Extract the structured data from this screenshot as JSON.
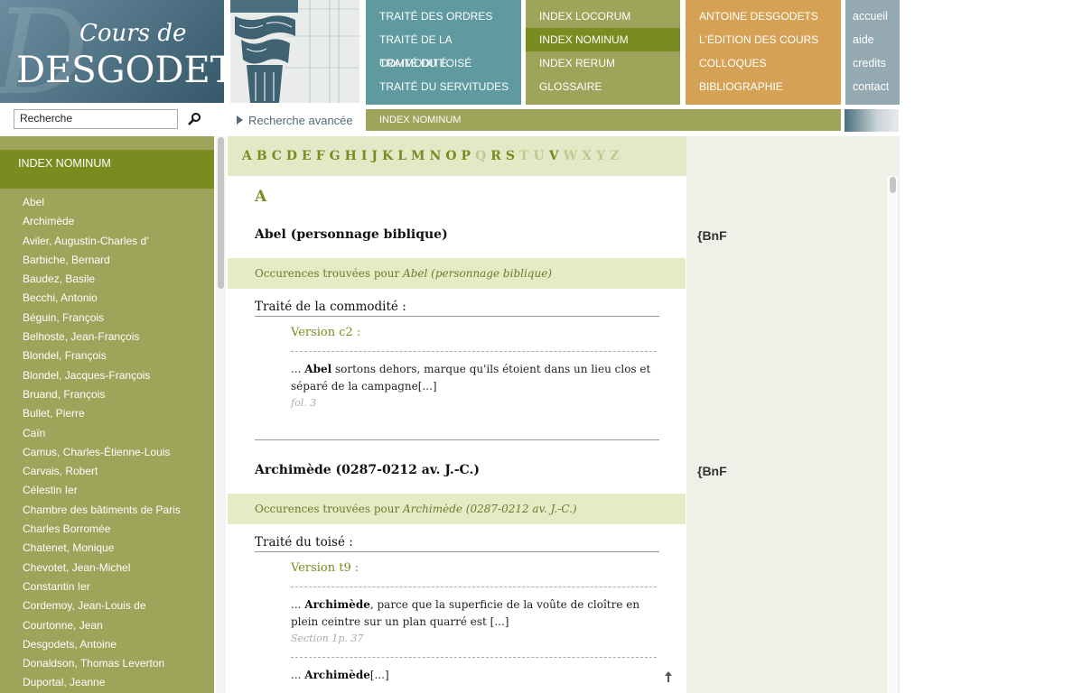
{
  "logo": {
    "line1": "Cours de",
    "line2": "DESGODETS",
    "watermark": "D"
  },
  "nav": {
    "col1": [
      "TRAITÉ DES ORDRES",
      "TRAITÉ DE LA COMMODITÉ",
      "TRAITÉ DU TOISÉ",
      "TRAITÉ DU SERVITUDES"
    ],
    "col2": [
      "INDEX LOCORUM",
      "INDEX NOMINUM",
      "INDEX RERUM",
      "GLOSSAIRE"
    ],
    "col3": [
      "ANTOINE DESGODETS",
      "L'ÉDITION DES COURS",
      "COLLOQUES",
      "BIBLIOGRAPHIE"
    ],
    "col4": [
      "accueil",
      "aide",
      "credits",
      "contact"
    ],
    "active": "INDEX NOMINUM",
    "colors": {
      "col1": "#5f9aa0",
      "col2": "#9ea45a",
      "col3": "#d4a155",
      "col4": "#94a9b1",
      "active": "#7a8c1f"
    }
  },
  "search": {
    "value": "Recherche",
    "advanced_label": "Recherche avancée"
  },
  "breadcrumb": "INDEX NOMINUM",
  "sidebar": {
    "heading": "INDEX NOMINUM",
    "items": [
      "Abel",
      "Archimède",
      "Aviler, Augustin-Charles d'",
      "Barbiche, Bernard",
      "Baudez, Basile",
      "Becchi, Antonio",
      "Béguin, François",
      "Belhoste, Jean-François",
      "Blondel, François",
      "Blondel, Jacques-François",
      "Bruand, François",
      "Bullet, Pierre",
      "Caïn",
      "Camus, Charles-Étienne-Louis",
      "Carvais, Robert",
      "Célestin Ier",
      "Chambre des bâtiments de Paris",
      "Charles Borromée",
      "Chatenet, Monique",
      "Chevotet, Jean-Michel",
      "Constantin Ier",
      "Cordemoy, Jean-Louis de",
      "Courtonne, Jean",
      "Desgodets, Antoine",
      "Donaldson, Thomas Leverton",
      "Duportal, Jeanne"
    ]
  },
  "alphabet": {
    "letters": [
      "A",
      "B",
      "C",
      "D",
      "E",
      "F",
      "G",
      "H",
      "I",
      "J",
      "K",
      "L",
      "M",
      "N",
      "O",
      "P",
      "Q",
      "R",
      "S",
      "T",
      "U",
      "V",
      "W",
      "X",
      "Y",
      "Z"
    ],
    "disabled": [
      "Q",
      "T",
      "U",
      "W",
      "X",
      "Y",
      "Z"
    ]
  },
  "current_letter": "A",
  "entries": [
    {
      "title": "Abel (personnage biblique)",
      "occ_prefix": "Occurences trouvées pour ",
      "occ_name": "Abel (personnage biblique)",
      "treatise": "Traité de la commodité :",
      "version": "Version c2 :",
      "ex_lead": "... ",
      "ex_bold": "Abel",
      "ex_rest": " sortons dehors, marque qu'ils étoient dans un lieu clos et séparé de la campagne[...]",
      "ref": "fol. 3",
      "bnf": "{BnF"
    },
    {
      "title": "Archimède (0287-0212 av. J.-C.)",
      "occ_prefix": "Occurences trouvées pour ",
      "occ_name": "Archimède (0287-0212 av. J.-C.)",
      "treatise": "Traité du toisé :",
      "version": "Version t9 :",
      "ex_lead": "... ",
      "ex_bold": "Archimède",
      "ex_rest": ", parce que la superficie de la voûte de cloître en plein ceintre sur un plan quarré est [...]",
      "ref": "Section 1p. 37",
      "ex2_lead": "... ",
      "ex2_bold": "Archimède",
      "ex2_rest": "[...]",
      "bnf": "{BnF"
    }
  ]
}
